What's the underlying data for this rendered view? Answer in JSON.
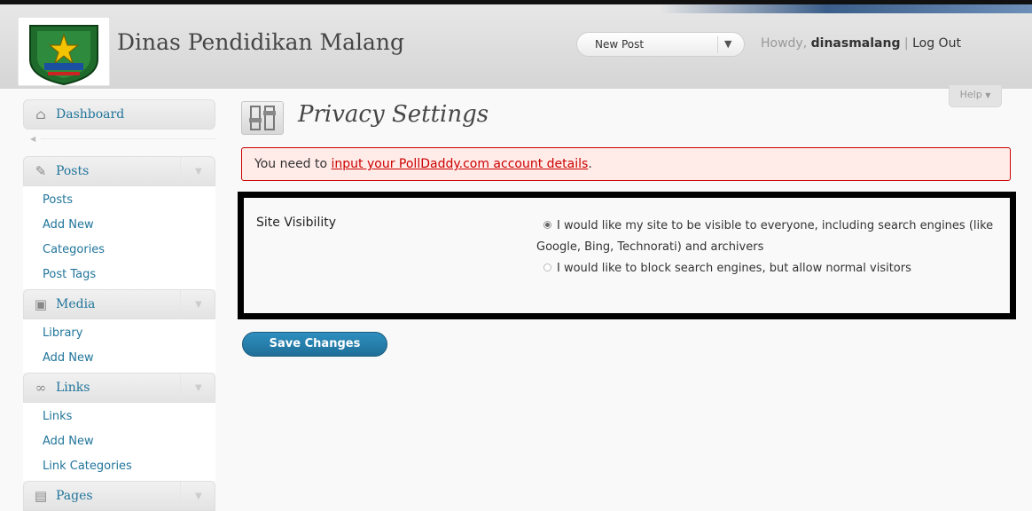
{
  "header": {
    "site_title": "Dinas Pendidikan Malang",
    "favorite_action": "New Post",
    "greeting": "Howdy,",
    "username": "dinasmalang",
    "logout": "Log Out",
    "logo_icon": "malang-crest-logo"
  },
  "sidebar": {
    "dashboard": "Dashboard",
    "posts": {
      "label": "Posts",
      "items": [
        "Posts",
        "Add New",
        "Categories",
        "Post Tags"
      ]
    },
    "media": {
      "label": "Media",
      "items": [
        "Library",
        "Add New"
      ]
    },
    "links": {
      "label": "Links",
      "items": [
        "Links",
        "Add New",
        "Link Categories"
      ]
    },
    "pages": {
      "label": "Pages"
    }
  },
  "main": {
    "help": "Help",
    "page_title": "Privacy Settings",
    "notice": {
      "prefix": "You need to ",
      "link": "input your PollDaddy.com account details",
      "suffix": "."
    },
    "site_visibility": {
      "label": "Site Visibility",
      "option_visible": "I would like my site to be visible to everyone, including search engines (like Google, Bing, Technorati) and archivers",
      "option_block": "I would like to block search engines, but allow normal visitors",
      "selected": "option_visible"
    },
    "save_button": "Save Changes"
  },
  "colors": {
    "link_blue": "#21759b",
    "notice_bg": "#ffebe8",
    "notice_border": "#cc0000",
    "button_blue": "#2e8fbf"
  }
}
